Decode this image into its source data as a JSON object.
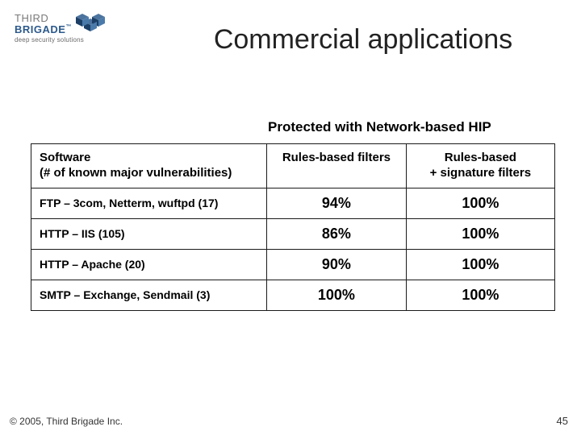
{
  "brand": {
    "line1": "THIRD",
    "line2": "BRIGADE",
    "tag": "deep security solutions"
  },
  "title": "Commercial applications",
  "subtitle": "Protected with Network-based HIP",
  "table": {
    "headers": {
      "software": "Software\n(# of known major vulnerabilities)",
      "rules": "Rules-based filters",
      "rules_sig": "Rules-based\n+ signature filters"
    },
    "rows": [
      {
        "software": "FTP – 3com, Netterm, wuftpd (17)",
        "rules": "94%",
        "rules_sig": "100%"
      },
      {
        "software": "HTTP – IIS (105)",
        "rules": "86%",
        "rules_sig": "100%"
      },
      {
        "software": "HTTP – Apache (20)",
        "rules": "90%",
        "rules_sig": "100%"
      },
      {
        "software": "SMTP – Exchange, Sendmail (3)",
        "rules": "100%",
        "rules_sig": "100%"
      }
    ]
  },
  "footer": {
    "copyright": "© 2005, Third Brigade Inc.",
    "page": "45"
  },
  "chart_data": {
    "type": "table",
    "title": "Commercial applications — Protected with Network-based HIP",
    "columns": [
      "Software (# of known major vulnerabilities)",
      "Rules-based filters",
      "Rules-based + signature filters"
    ],
    "rows": [
      [
        "FTP – 3com, Netterm, wuftpd (17)",
        "94%",
        "100%"
      ],
      [
        "HTTP – IIS (105)",
        "86%",
        "100%"
      ],
      [
        "HTTP – Apache (20)",
        "90%",
        "100%"
      ],
      [
        "SMTP – Exchange, Sendmail (3)",
        "100%",
        "100%"
      ]
    ]
  }
}
